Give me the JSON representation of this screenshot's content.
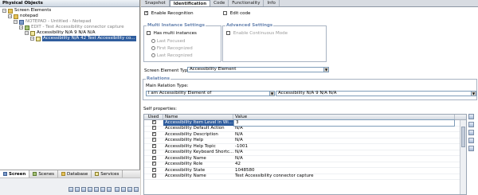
{
  "left_panel": {
    "title": "Physical Objects",
    "tree": [
      {
        "label": "Screen Elements",
        "icon": "folder-icon",
        "indent": 0
      },
      {
        "label": "notepad",
        "icon": "folder-icon",
        "indent": 1
      },
      {
        "label": "NOTEPAD - Untitled - Notepad",
        "icon": "window-icon",
        "indent": 2,
        "dim": true
      },
      {
        "label": "EDIT - Test Accessibility connector capture",
        "icon": "app-icon",
        "indent": 3,
        "dim": true
      },
      {
        "label": "Accessibility N/A 9 N/A N/A",
        "icon": "accessible-element-icon",
        "indent": 4
      },
      {
        "label": "Accessibility N/A 42 Test Accessibility co...",
        "icon": "accessible-element-icon",
        "indent": 5,
        "selected": true
      }
    ],
    "tabs": [
      "Screen",
      "Scenes",
      "Database",
      "Services"
    ]
  },
  "tabs": [
    "Snapshot",
    "Identification",
    "Code",
    "Functionality",
    "Info"
  ],
  "identification": {
    "enable_recognition": "Enable Recognition",
    "edit_code": "Edit code",
    "multi_instance": {
      "title": "Multi Instance Settings",
      "has_multi": "Has multi instances",
      "options": [
        "Last Focused",
        "First Recognized",
        "Last Recognized"
      ]
    },
    "advanced": {
      "title": "Advanced Settings",
      "enable_continuous": "Enable Continuous Mode"
    },
    "screen_element_type_label": "Screen Element Type:",
    "screen_element_type_value": "Accessibility Element",
    "relations": {
      "title": "Relations",
      "main_relation_label": "Main Relation Type:",
      "relation_value": "I am Accessibility Element of",
      "target_value": "Accessibility N/A 9 N/A N/A"
    },
    "self_properties_label": "Self properties:",
    "grid": {
      "headers": [
        "Used",
        "Name",
        "Value"
      ],
      "rows": [
        {
          "used": true,
          "name": "Accessibility Item Level in Wi...",
          "value": "3",
          "selected": true
        },
        {
          "used": true,
          "name": "Accessibility Default Action",
          "value": "N/A"
        },
        {
          "used": true,
          "name": "Accessibility Description",
          "value": "N/A"
        },
        {
          "used": true,
          "name": "Accessibility Help",
          "value": "N/A"
        },
        {
          "used": true,
          "name": "Accessibility Help Topic",
          "value": "-1001"
        },
        {
          "used": true,
          "name": "Accessibility Keyboard Shortc...",
          "value": "N/A"
        },
        {
          "used": true,
          "name": "Accessibility Name",
          "value": "N/A"
        },
        {
          "used": true,
          "name": "Accessibility Role",
          "value": "42"
        },
        {
          "used": true,
          "name": "Accessibility State",
          "value": "1048580"
        },
        {
          "used": true,
          "name": "Accessibility Name",
          "value": "Test Accessibility connector capture"
        }
      ]
    }
  },
  "colors": {
    "selection": "#2f5d9e",
    "group_title": "#6a86b1",
    "panel_bg": "#d4d0c8"
  }
}
